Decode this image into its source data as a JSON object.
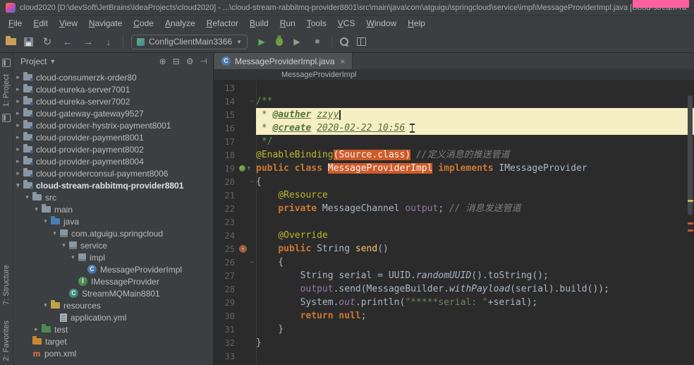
{
  "title_bar": {
    "app_icon": "intellij-logo-icon",
    "title": "cloud2020 [D:\\devSoft\\JetBrains\\IdeaProjects\\cloud2020] - ...\\cloud-stream-rabbitmq-provider8801\\src\\main\\java\\com\\atguigu\\springcloud\\service\\impl\\MessageProviderImpl.java [cloud-stream-ra"
  },
  "annotation": {
    "type": "pink-highlight-box",
    "color": "#FF5FA2"
  },
  "menu": {
    "items": [
      "File",
      "Edit",
      "View",
      "Navigate",
      "Code",
      "Analyze",
      "Refactor",
      "Build",
      "Run",
      "Tools",
      "VCS",
      "Window",
      "Help"
    ]
  },
  "toolbar": {
    "left_icons": [
      "open-folder",
      "save-all",
      "synchronize",
      "back",
      "forward",
      "update-project"
    ],
    "run_config": "ConfigClientMain3366",
    "right_icons": [
      "run",
      "debug",
      "coverage",
      "stop"
    ],
    "far_icons": [
      "find",
      "layout"
    ]
  },
  "tool_stripe": {
    "top": [
      "1: Project"
    ],
    "bottom": [
      "7: Structure",
      "2: Favorites"
    ]
  },
  "project_panel": {
    "header": "Project",
    "header_icons": [
      "locate",
      "collapse-all",
      "settings",
      "hide"
    ],
    "tree": [
      {
        "label": "cloud-consumerzk-order80",
        "depth": 0,
        "icon": "module",
        "chevron": "collapsed"
      },
      {
        "label": "cloud-eureka-server7001",
        "depth": 0,
        "icon": "module",
        "chevron": "collapsed"
      },
      {
        "label": "cloud-eureka-server7002",
        "depth": 0,
        "icon": "module",
        "chevron": "collapsed"
      },
      {
        "label": "cloud-gateway-gateway9527",
        "depth": 0,
        "icon": "module",
        "chevron": "collapsed"
      },
      {
        "label": "cloud-provider-hystrix-payment8001",
        "depth": 0,
        "icon": "module",
        "chevron": "collapsed"
      },
      {
        "label": "cloud-provider-payment8001",
        "depth": 0,
        "icon": "module",
        "chevron": "collapsed"
      },
      {
        "label": "cloud-provider-payment8002",
        "depth": 0,
        "icon": "module",
        "chevron": "collapsed"
      },
      {
        "label": "cloud-provider-payment8004",
        "depth": 0,
        "icon": "module",
        "chevron": "collapsed"
      },
      {
        "label": "cloud-providerconsul-payment8006",
        "depth": 0,
        "icon": "module",
        "chevron": "collapsed"
      },
      {
        "label": "cloud-stream-rabbitmq-provider8801",
        "depth": 0,
        "icon": "module",
        "chevron": "expanded",
        "bold": true
      },
      {
        "label": "src",
        "depth": 1,
        "icon": "folder",
        "chevron": "expanded"
      },
      {
        "label": "main",
        "depth": 2,
        "icon": "folder",
        "chevron": "expanded"
      },
      {
        "label": "java",
        "depth": 3,
        "icon": "folder-src",
        "chevron": "expanded"
      },
      {
        "label": "com.atguigu.springcloud",
        "depth": 4,
        "icon": "package",
        "chevron": "expanded"
      },
      {
        "label": "service",
        "depth": 5,
        "icon": "package",
        "chevron": "expanded"
      },
      {
        "label": "impl",
        "depth": 6,
        "icon": "package",
        "chevron": "expanded"
      },
      {
        "label": "MessageProviderImpl",
        "depth": 7,
        "icon": "class",
        "chevron": "none"
      },
      {
        "label": "IMessageProvider",
        "depth": 6,
        "icon": "interface",
        "chevron": "none"
      },
      {
        "label": "StreamMQMain8801",
        "depth": 5,
        "icon": "class-main",
        "chevron": "none"
      },
      {
        "label": "resources",
        "depth": 3,
        "icon": "folder-res",
        "chevron": "expanded"
      },
      {
        "label": "application.yml",
        "depth": 4,
        "icon": "file-yml",
        "chevron": "none"
      },
      {
        "label": "test",
        "depth": 2,
        "icon": "folder-test",
        "chevron": "collapsed"
      },
      {
        "label": "target",
        "depth": 1,
        "icon": "folder-excl",
        "chevron": "none"
      },
      {
        "label": "pom.xml",
        "depth": 1,
        "icon": "maven",
        "chevron": "none"
      }
    ]
  },
  "editor": {
    "tab": {
      "label": "MessageProviderImpl.java",
      "icon": "class-icon",
      "close": "close-icon"
    },
    "breadcrumb": "MessageProviderImpl",
    "lines": [
      {
        "n": 13,
        "seg": []
      },
      {
        "n": 14,
        "fold": true,
        "seg": [
          [
            "d",
            "/**"
          ]
        ]
      },
      {
        "n": 15,
        "bg": "cream",
        "seg": [
          [
            "d",
            " * "
          ],
          [
            "dt",
            "@auther"
          ],
          [
            "d",
            " "
          ],
          [
            "dv",
            "zzyy"
          ],
          [
            "caret",
            ""
          ]
        ]
      },
      {
        "n": 16,
        "bg": "cream",
        "seg": [
          [
            "d",
            " * "
          ],
          [
            "dt",
            "@create"
          ],
          [
            "d",
            " "
          ],
          [
            "dv",
            "2020-02-22 10:56"
          ],
          [
            "ibeam",
            ""
          ]
        ]
      },
      {
        "n": 17,
        "seg": [
          [
            "d",
            " */"
          ]
        ]
      },
      {
        "n": 18,
        "seg": [
          [
            "a",
            "@EnableBinding"
          ],
          [
            "hl",
            "(Source.class)"
          ],
          [
            "p",
            " "
          ],
          [
            "c",
            "//定义消息的推送管道"
          ]
        ]
      },
      {
        "n": 19,
        "gutter": [
          "bean",
          "impl"
        ],
        "seg": [
          [
            "k",
            "public class "
          ],
          [
            "hl",
            "MessageProviderImpl"
          ],
          [
            "p",
            " "
          ],
          [
            "k",
            "implements"
          ],
          [
            "p",
            " IMessageProvider"
          ]
        ]
      },
      {
        "n": 20,
        "fold": true,
        "seg": [
          [
            "p",
            "{"
          ]
        ]
      },
      {
        "n": 21,
        "seg": [
          [
            "p",
            "    "
          ],
          [
            "a",
            "@Resource"
          ]
        ]
      },
      {
        "n": 22,
        "seg": [
          [
            "p",
            "    "
          ],
          [
            "k",
            "private"
          ],
          [
            "p",
            " MessageChannel "
          ],
          [
            "f",
            "output"
          ],
          [
            "p",
            "; "
          ],
          [
            "c",
            "// 消息发送管道"
          ]
        ]
      },
      {
        "n": 23,
        "seg": []
      },
      {
        "n": 24,
        "seg": [
          [
            "p",
            "    "
          ],
          [
            "a",
            "@Override"
          ]
        ]
      },
      {
        "n": 25,
        "gutter": [
          "override"
        ],
        "seg": [
          [
            "p",
            "    "
          ],
          [
            "k",
            "public"
          ],
          [
            "p",
            " String "
          ],
          [
            "m",
            "send"
          ],
          [
            "p",
            "()"
          ]
        ]
      },
      {
        "n": 26,
        "fold": true,
        "seg": [
          [
            "p",
            "    {"
          ]
        ]
      },
      {
        "n": 27,
        "seg": [
          [
            "p",
            "        String serial = UUID."
          ],
          [
            "sm",
            "randomUUID"
          ],
          [
            "p",
            "().toString();"
          ]
        ]
      },
      {
        "n": 28,
        "seg": [
          [
            "p",
            "        "
          ],
          [
            "f",
            "output"
          ],
          [
            "p",
            ".send(MessageBuilder."
          ],
          [
            "sm",
            "withPayload"
          ],
          [
            "p",
            "(serial).build());"
          ]
        ]
      },
      {
        "n": 29,
        "seg": [
          [
            "p",
            "        System."
          ],
          [
            "fi",
            "out"
          ],
          [
            "p",
            ".println("
          ],
          [
            "s",
            "\"*****serial: \""
          ],
          [
            "p",
            "+serial);"
          ]
        ]
      },
      {
        "n": 30,
        "seg": [
          [
            "p",
            "        "
          ],
          [
            "k",
            "return null"
          ],
          [
            "p",
            ";"
          ]
        ]
      },
      {
        "n": 31,
        "seg": [
          [
            "p",
            "    }"
          ]
        ]
      },
      {
        "n": 32,
        "seg": [
          [
            "p",
            "}"
          ]
        ]
      },
      {
        "n": 33,
        "seg": []
      }
    ]
  },
  "colors": {
    "panel_bg": "#3C3F41",
    "editor_bg": "#2B2B2B",
    "occurrence_highlight": "#CE5B2A",
    "doc_line_highlight": "#F6EFC5",
    "annotation_pink": "#FF5FA2",
    "keyword": "#CC7832",
    "annotation_code": "#BBB529",
    "string": "#6A8759",
    "comment": "#7F7F7F",
    "doc_comment": "#629755",
    "field": "#9876AA"
  }
}
